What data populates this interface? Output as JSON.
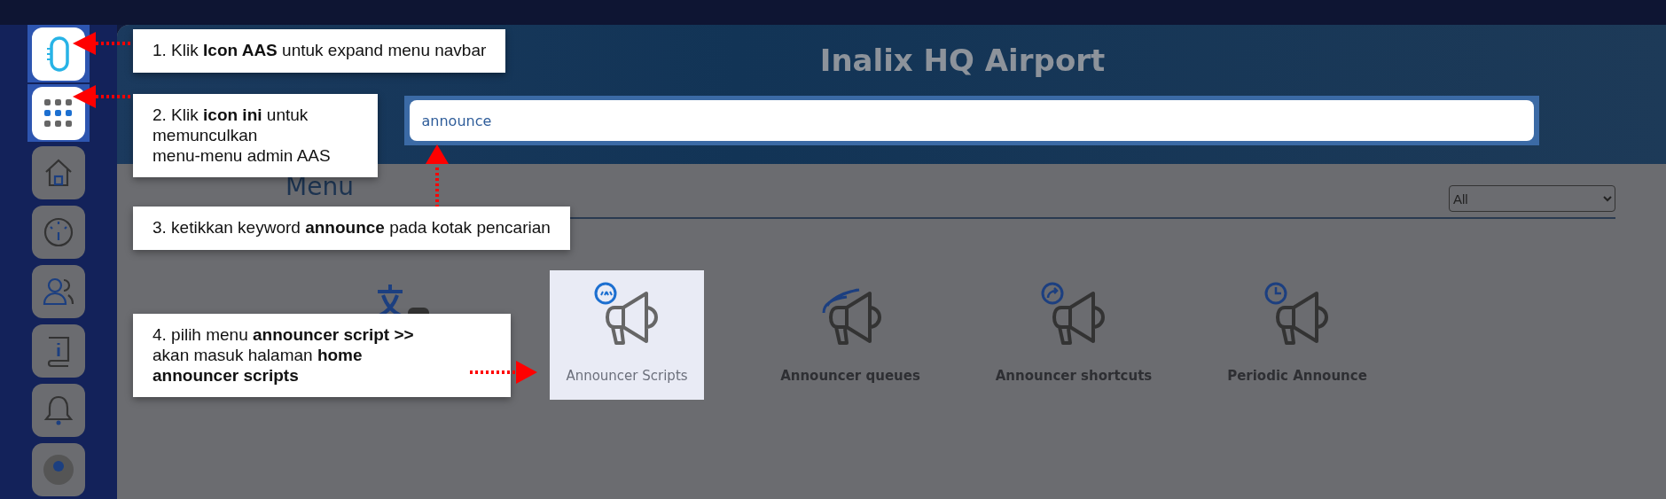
{
  "sidebar": {
    "items": [
      {
        "kind": "aas",
        "highlighted": true
      },
      {
        "kind": "apps",
        "highlighted": true
      },
      {
        "kind": "home",
        "highlighted": false
      },
      {
        "kind": "gauge",
        "highlighted": false
      },
      {
        "kind": "users",
        "highlighted": false
      },
      {
        "kind": "info",
        "highlighted": false
      },
      {
        "kind": "bell",
        "highlighted": false
      },
      {
        "kind": "avatar",
        "highlighted": false
      }
    ]
  },
  "header": {
    "title": "Inalix HQ Airport",
    "search": {
      "value": "announce"
    }
  },
  "menu": {
    "title": "Menu",
    "filter": "All",
    "items": [
      {
        "kind": "translate",
        "selected": false
      },
      {
        "kind": "script",
        "label": "Announcer Scripts",
        "selected": true
      },
      {
        "kind": "queue",
        "label": "Announcer queues",
        "selected": false
      },
      {
        "kind": "shortcut",
        "label": "Announcer shortcuts",
        "selected": false
      },
      {
        "kind": "periodic",
        "label": "Periodic Announce",
        "selected": false
      }
    ]
  },
  "callouts": [
    {
      "kind": "left",
      "text": "1. Klik **Icon AAS** untuk expand menu navbar"
    },
    {
      "kind": "left",
      "text": "2. Klik **icon ini** untuk\nmemunculkan\nmenu-menu admin AAS"
    },
    {
      "kind": "up",
      "text": "3. ketikkan keyword **announce** pada kotak pencarian"
    },
    {
      "kind": "right",
      "text": "4. pilih menu **announcer script >>**\nakan masuk halaman **home**\n**announcer scripts**"
    }
  ]
}
